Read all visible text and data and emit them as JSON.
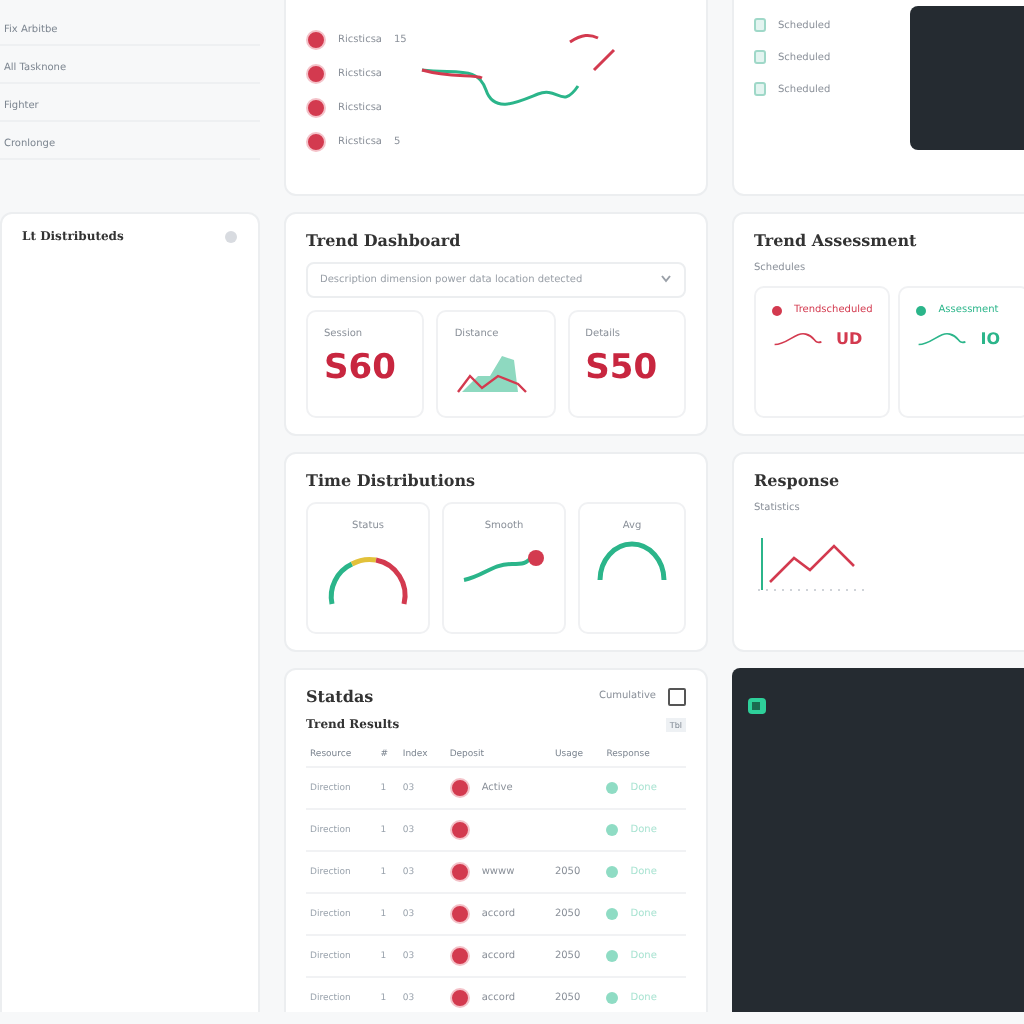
{
  "sidebar": {
    "items": [
      {
        "label": "Fix Arbitbe"
      },
      {
        "label": "All Tasknone"
      },
      {
        "label": "Fighter"
      },
      {
        "label": "Cronlonge"
      }
    ],
    "panel_title": "Lt Distributeds"
  },
  "activity": {
    "rows": [
      {
        "label": "Ricsticsa",
        "note": "15"
      },
      {
        "label": "Ricsticsa"
      },
      {
        "label": "Ricsticsa"
      },
      {
        "label": "Ricsticsa",
        "note": "5"
      }
    ]
  },
  "files": {
    "items": [
      "Scheduled",
      "Scheduled",
      "Scheduled"
    ]
  },
  "trend_dashboard": {
    "title": "Trend Dashboard",
    "select": "Description dimension power data location detected",
    "stats": [
      {
        "kind": "value",
        "label": "Session",
        "value": "S60"
      },
      {
        "kind": "chart",
        "label": "Distance"
      },
      {
        "kind": "value",
        "label": "Details",
        "value": "S50"
      }
    ]
  },
  "trend_assessment": {
    "title": "Trend Assessment",
    "subtitle": "Schedules",
    "cards": [
      {
        "label": "Trendscheduled",
        "color": "#d33a4f",
        "value": "UD"
      },
      {
        "label": "Assessment",
        "color": "#2bb58a",
        "value": "IO"
      }
    ]
  },
  "time_distributions": {
    "title": "Time Distributions",
    "gauges": [
      {
        "kind": "multi-arc",
        "label": "Status"
      },
      {
        "kind": "line",
        "label": "Smooth"
      },
      {
        "kind": "arc",
        "label": "Avg"
      }
    ]
  },
  "response": {
    "title": "Response",
    "label": "Statistics"
  },
  "table": {
    "title": "Statdas",
    "toggle": "Cumulative",
    "checked": false,
    "subtitle": "Trend Results",
    "badge": "Tbl",
    "columns": [
      "Resource",
      "#",
      "Index",
      "Deposit",
      "Usage",
      "Response"
    ],
    "rows": [
      {
        "cells": [
          "Direction",
          "1",
          "03",
          "Active",
          ""
        ],
        "status": "Done"
      },
      {
        "cells": [
          "Direction",
          "1",
          "03",
          "",
          ""
        ],
        "status": "Done"
      },
      {
        "cells": [
          "Direction",
          "1",
          "03",
          "wwww",
          "2050"
        ],
        "status": "Done"
      },
      {
        "cells": [
          "Direction",
          "1",
          "03",
          "accord",
          "2050"
        ],
        "status": "Done"
      },
      {
        "cells": [
          "Direction",
          "1",
          "03",
          "accord",
          "2050"
        ],
        "status": "Done"
      },
      {
        "cells": [
          "Direction",
          "1",
          "03",
          "accord",
          "2050"
        ],
        "status": "Done"
      }
    ]
  }
}
